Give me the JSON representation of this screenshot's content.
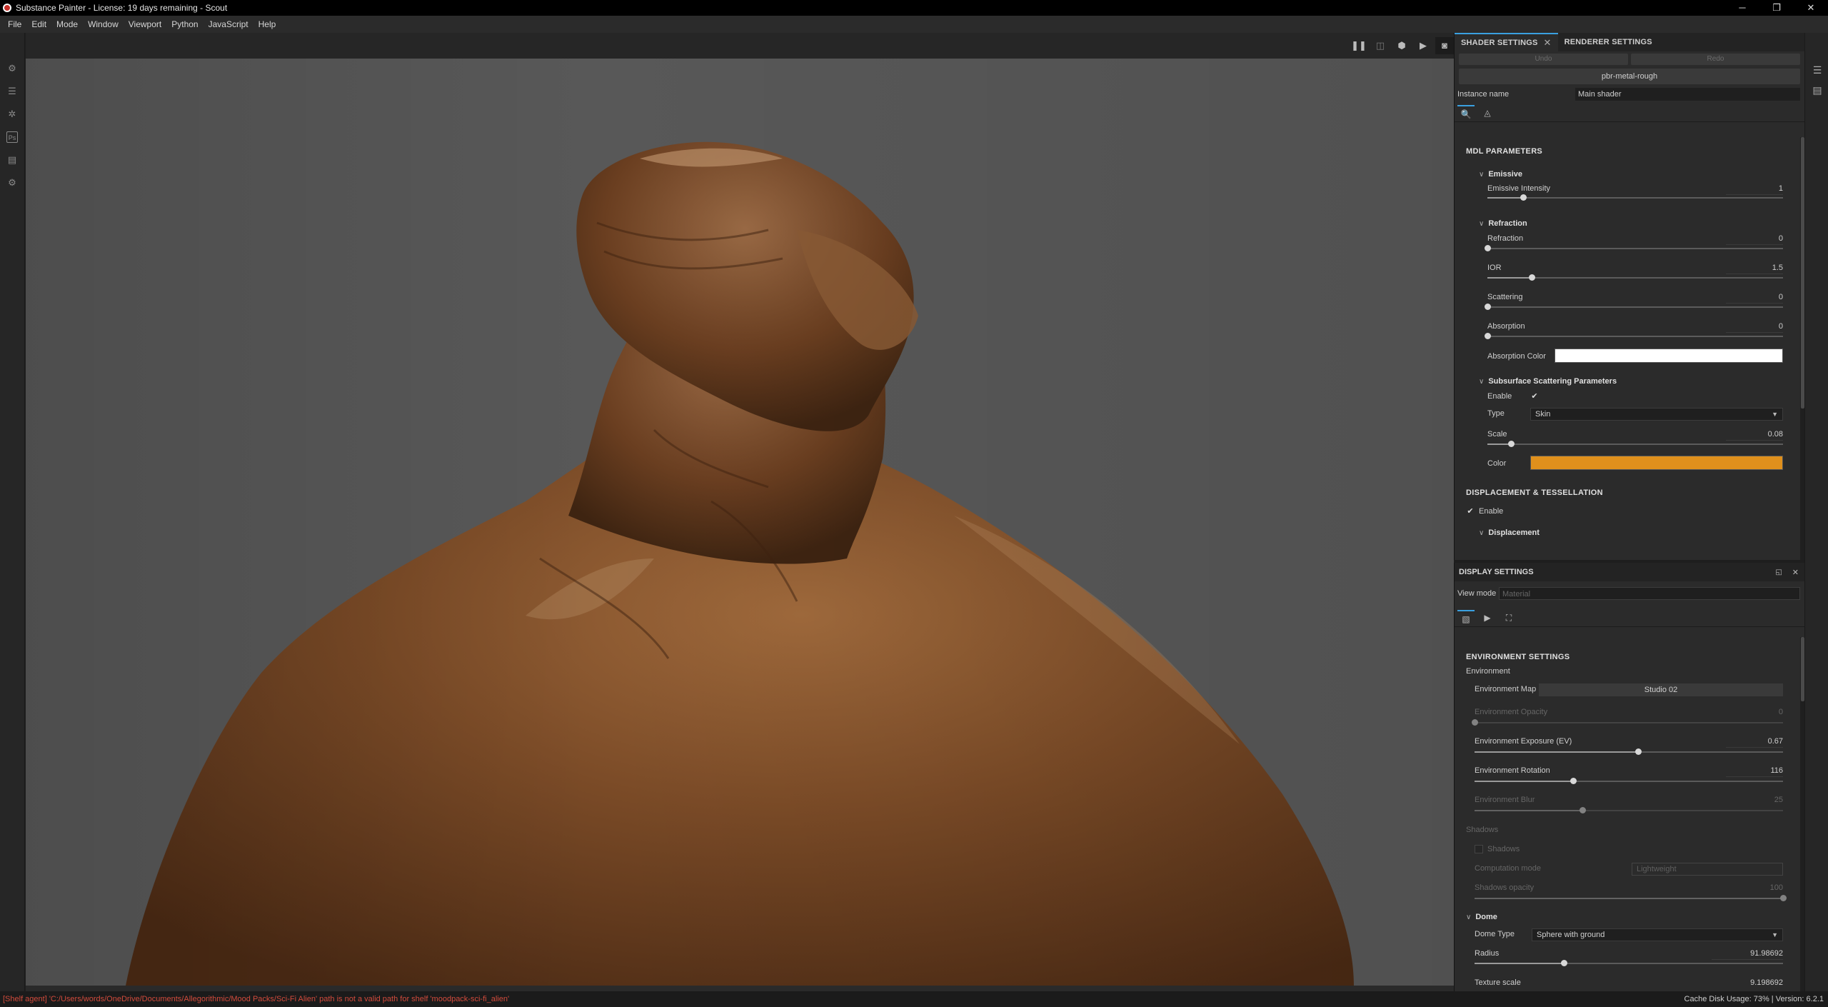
{
  "titlebar": {
    "title": "Substance Painter - License: 19 days remaining - Scout",
    "minimize": "─",
    "restore": "❐",
    "close": "✕"
  },
  "menu": [
    "File",
    "Edit",
    "Mode",
    "Window",
    "Viewport",
    "Python",
    "JavaScript",
    "Help"
  ],
  "left_toolbar_icons": [
    "settings-icon",
    "layers-stack-icon",
    "gear-small-icon",
    "ps-icon",
    "document-icon",
    "gear-icon"
  ],
  "viewport_toolbar_icons": [
    "pause-icon",
    "split-view-icon",
    "cube-icon",
    "camera-icon",
    "screenshot-icon"
  ],
  "shader_panel": {
    "tabs": [
      {
        "label": "SHADER SETTINGS",
        "active": true,
        "close": "✕"
      },
      {
        "label": "RENDERER SETTINGS",
        "active": false
      }
    ],
    "undo": "Undo",
    "redo": "Redo",
    "shader_name": "pbr-metal-rough",
    "instance_label": "Instance name",
    "instance_value": "Main shader",
    "mdl_title": "MDL PARAMETERS",
    "emissive": {
      "title": "Emissive",
      "intensity_label": "Emissive Intensity",
      "intensity_value": "1",
      "intensity_fraction": 0.12
    },
    "refraction": {
      "title": "Refraction",
      "params": [
        {
          "label": "Refraction",
          "value": "0",
          "fraction": 0.0
        },
        {
          "label": "IOR",
          "value": "1.5",
          "fraction": 0.15
        },
        {
          "label": "Scattering",
          "value": "0",
          "fraction": 0.0
        },
        {
          "label": "Absorption",
          "value": "0",
          "fraction": 0.0
        }
      ],
      "absorption_color_label": "Absorption Color",
      "absorption_color": "#ffffff"
    },
    "sss": {
      "title": "Subsurface Scattering Parameters",
      "enable_label": "Enable",
      "enable_check": "✔",
      "type_label": "Type",
      "type_value": "Skin",
      "scale_label": "Scale",
      "scale_value": "0.08",
      "scale_fraction": 0.08,
      "color_label": "Color",
      "color": "#e0901c"
    },
    "displacement_title": "DISPLACEMENT & TESSELLATION",
    "displacement_enable": "Enable",
    "displacement_check": "✔",
    "displacement_group": "Displacement"
  },
  "display_panel": {
    "title": "DISPLAY SETTINGS",
    "view_mode_label": "View mode",
    "view_mode_placeholder": "Material",
    "env_section": "ENVIRONMENT SETTINGS",
    "env_group": "Environment",
    "env_map_label": "Environment Map",
    "env_map_value": "Studio 02",
    "env_params": [
      {
        "label": "Environment Opacity",
        "value": "0",
        "fraction": 0.0,
        "disabled": true
      },
      {
        "label": "Environment Exposure (EV)",
        "value": "0.67",
        "fraction": 0.53,
        "disabled": false
      },
      {
        "label": "Environment Rotation",
        "value": "116",
        "fraction": 0.32,
        "disabled": false
      },
      {
        "label": "Environment Blur",
        "value": "25",
        "fraction": 0.35,
        "disabled": true
      }
    ],
    "shadows_group": "Shadows",
    "shadows_check_label": "Shadows",
    "computation_label": "Computation mode",
    "computation_value": "Lightweight",
    "shadows_opacity_label": "Shadows opacity",
    "shadows_opacity_value": "100",
    "shadows_opacity_fraction": 1.0,
    "dome_title": "Dome",
    "dome_type_label": "Dome Type",
    "dome_type_value": "Sphere with ground",
    "radius_label": "Radius",
    "radius_value": "91.98692",
    "radius_fraction": 0.29,
    "texture_scale_label": "Texture scale",
    "texture_scale_value": "9.198692"
  },
  "statusbar": {
    "message": "[Shelf agent] 'C:/Users/words/OneDrive/Documents/Allegorithmic/Mood Packs/Sci-Fi Alien' path is not a valid path for shelf 'moodpack-sci-fi_alien'",
    "message_color": "#d24b3c",
    "cache_usage": "Cache Disk Usage:   73% | Version: 6.2.1"
  },
  "colors": {
    "accent": "#3aa0e0",
    "viewport_bg": "#585858",
    "model_skin": "#7a4a28"
  }
}
